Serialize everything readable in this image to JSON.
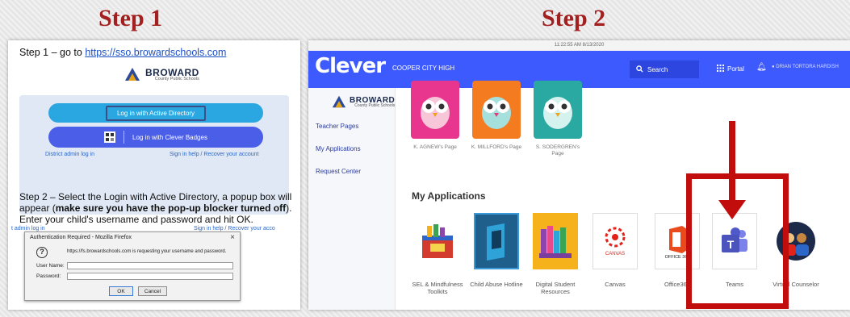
{
  "steps": {
    "step1": "Step 1",
    "step2": "Step 2"
  },
  "left": {
    "step1_prefix": "Step 1 – go to ",
    "step1_link": "https://sso.browardschools.com",
    "logo_word": "BROWARD",
    "logo_sub": "County Public Schools",
    "btn_active_directory": "Log in with Active Directory",
    "btn_clever_badges": "Log in with Clever Badges",
    "district_admin": "District admin log in",
    "sign_in_help": "Sign in help / Recover your account",
    "step2_text_a": "Step 2 – Select the Login with Active Directory, a popup box will appear (",
    "step2_bold": "make sure you have the pop-up blocker turned off",
    "step2_text_b": ").  Enter your child's username and password and hit OK.",
    "frag_left": "t admin log in",
    "frag_right": "Sign in help / Recover your acco",
    "auth": {
      "title": "Authentication Required - Mozilla Firefox",
      "close": "×",
      "message": "https://fs.browardschools.com is requesting your username and password.",
      "user_label": "User Name:",
      "pass_label": "Password:",
      "ok": "OK",
      "cancel": "Cancel"
    }
  },
  "right": {
    "timestamp": "11:22:55 AM 8/13/2020",
    "logo": "Clever",
    "school": "COOPER CITY HIGH",
    "search": "Search",
    "portal": "Portal",
    "user": "DRIAN TORTORA HARDISH",
    "sidebar": {
      "logo_word": "BROWARD",
      "logo_sub": "County Public Schools",
      "items": [
        "Teacher Pages",
        "My Applications",
        "Request Center"
      ]
    },
    "teachers": [
      {
        "label": "K. AGNEW's Page",
        "color": "#e8368f"
      },
      {
        "label": "K. MILLFORD's Page",
        "color": "#f47b20"
      },
      {
        "label": "S. SODERGREN's Page",
        "color": "#29a9a1"
      }
    ],
    "apps_heading": "My Applications",
    "apps": [
      {
        "label": "SEL & Mindfulness Toolkits"
      },
      {
        "label": "Child Abuse Hotline"
      },
      {
        "label": "Digital Student Resources"
      },
      {
        "label": "Canvas"
      },
      {
        "label": "Office365"
      },
      {
        "label": "Teams"
      },
      {
        "label": "Virtual Counselor"
      }
    ],
    "highlight_color": "#c20d0d"
  }
}
